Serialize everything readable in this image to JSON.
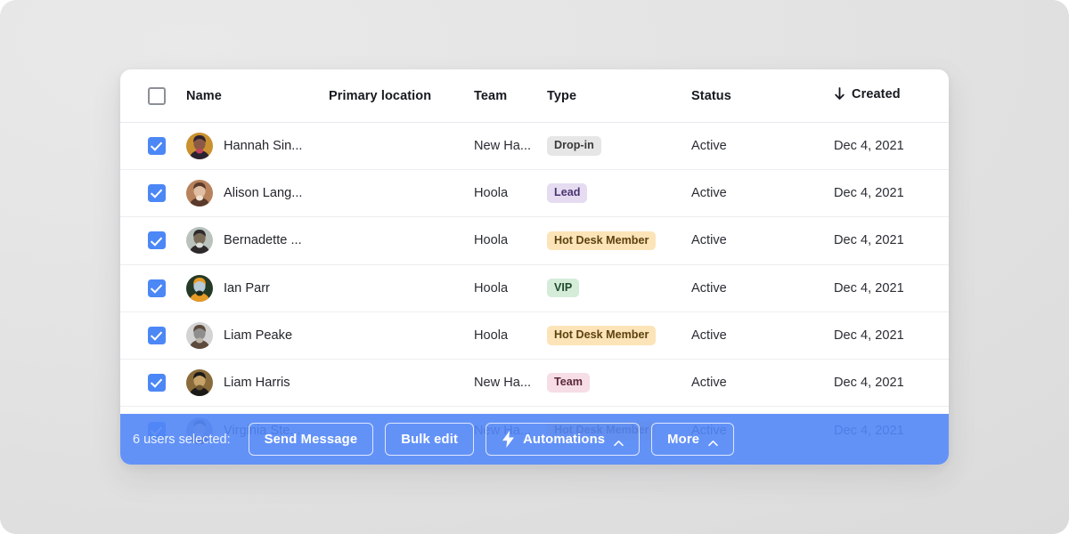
{
  "theme": {
    "accent": "#4c87f6",
    "toolbar_bg": "#5286f6",
    "card_bg": "#ffffff",
    "page_bg": "#e3e3e3"
  },
  "table": {
    "columns": [
      {
        "key": "select",
        "label": "",
        "sorted": false
      },
      {
        "key": "name",
        "label": "Name",
        "sorted": false
      },
      {
        "key": "location",
        "label": "Primary location",
        "sorted": false
      },
      {
        "key": "team",
        "label": "Team",
        "sorted": false
      },
      {
        "key": "type",
        "label": "Type",
        "sorted": false
      },
      {
        "key": "status",
        "label": "Status",
        "sorted": false
      },
      {
        "key": "created",
        "label": "Created",
        "sorted": true,
        "sort_direction": "descending",
        "sort_icon": "arrow-down-icon"
      }
    ],
    "select_all_checked": false,
    "rows": [
      {
        "selected": true,
        "name": "Hannah Sin...",
        "location": "",
        "team": "New Ha...",
        "type": "Drop-in",
        "type_color": "gray",
        "status": "Active",
        "created": "Dec 4, 2021",
        "avatar": "avatar-hannah"
      },
      {
        "selected": true,
        "name": "Alison Lang...",
        "location": "",
        "team": "Hoola",
        "type": "Lead",
        "type_color": "purple",
        "status": "Active",
        "created": "Dec 4, 2021",
        "avatar": "avatar-alison"
      },
      {
        "selected": true,
        "name": "Bernadette ...",
        "location": "",
        "team": "Hoola",
        "type": "Hot Desk Member",
        "type_color": "orange",
        "status": "Active",
        "created": "Dec 4, 2021",
        "avatar": "avatar-bernadette"
      },
      {
        "selected": true,
        "name": "Ian Parr",
        "location": "",
        "team": "Hoola",
        "type": "VIP",
        "type_color": "green",
        "status": "Active",
        "created": "Dec 4, 2021",
        "avatar": "avatar-ian"
      },
      {
        "selected": true,
        "name": "Liam Peake",
        "location": "",
        "team": "Hoola",
        "type": "Hot Desk Member",
        "type_color": "orange",
        "status": "Active",
        "created": "Dec 4, 2021",
        "avatar": "avatar-liam-peake"
      },
      {
        "selected": true,
        "name": "Liam Harris",
        "location": "",
        "team": "New Ha...",
        "type": "Team",
        "type_color": "pink",
        "status": "Active",
        "created": "Dec 4, 2021",
        "avatar": "avatar-liam-harris"
      },
      {
        "selected": true,
        "name": "Virginia Ste...",
        "location": "",
        "team": "New Ha...",
        "type": "Hot Desk Member",
        "type_color": "orange",
        "status": "Active",
        "created": "Dec 4, 2021",
        "avatar": "avatar-virginia"
      }
    ]
  },
  "selection_toolbar": {
    "count_label": "6 users selected:",
    "buttons": [
      {
        "id": "send-message",
        "label": "Send Message",
        "icon": null,
        "chevron": false
      },
      {
        "id": "bulk-edit",
        "label": "Bulk edit",
        "icon": null,
        "chevron": false
      },
      {
        "id": "automations",
        "label": "Automations",
        "icon": "lightning-icon",
        "chevron": true
      },
      {
        "id": "more",
        "label": "More",
        "icon": null,
        "chevron": true
      }
    ]
  }
}
